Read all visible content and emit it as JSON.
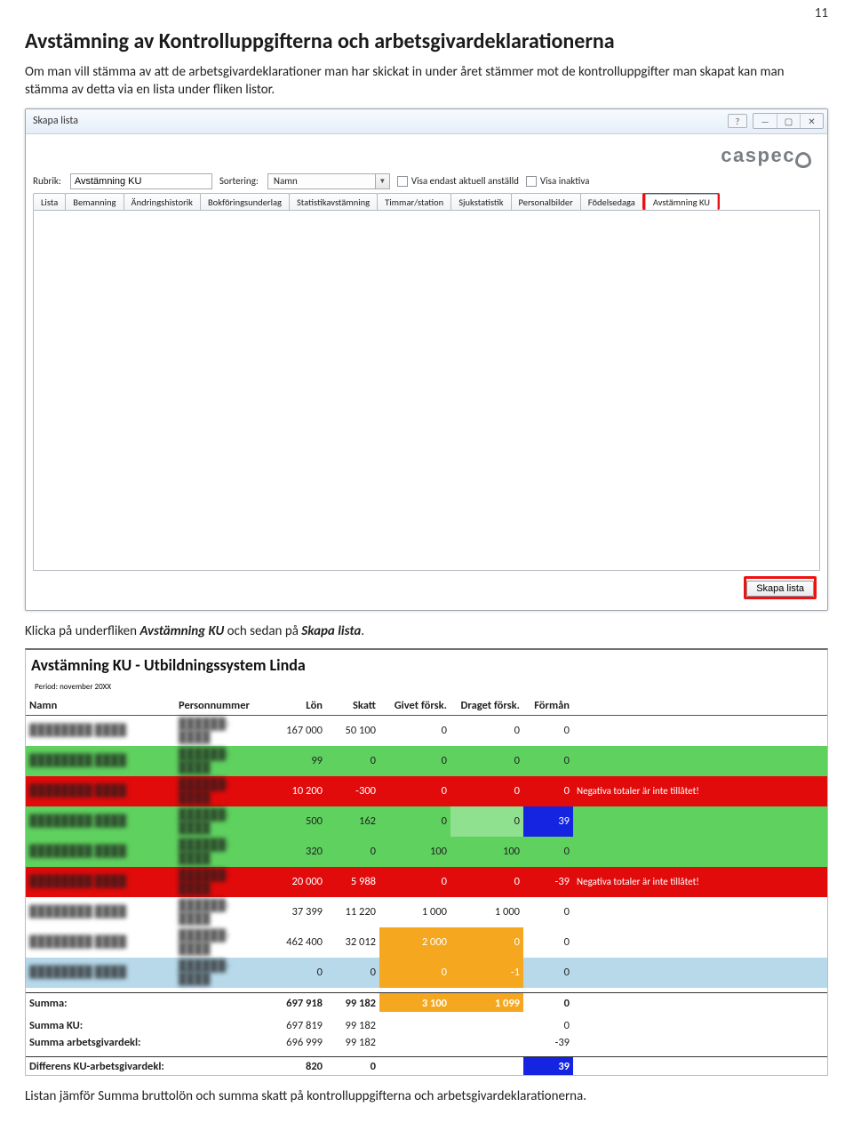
{
  "page_number": "11",
  "doc": {
    "title": "Avstämning av Kontrolluppgifterna och arbetsgivardeklarationerna",
    "intro": "Om man vill stämma av att de arbetsgivardeklarationer man har skickat in under året stämmer mot de kontrolluppgifter man skapat kan man stämma av detta via en lista under fliken listor.",
    "mid_prefix": "Klicka på underfliken ",
    "mid_tab": "Avstämning KU",
    "mid_mid": " och sedan på ",
    "mid_btn": "Skapa lista",
    "mid_suffix": ".",
    "final": "Listan jämför Summa bruttolön och summa skatt på kontrolluppgifterna och arbetsgivardeklarationerna."
  },
  "window": {
    "title": "Skapa lista",
    "help_icon": "?",
    "ctrl_min": "—",
    "ctrl_max": "▢",
    "ctrl_close": "✕",
    "logo": "caspeco",
    "labels": {
      "rubrik": "Rubrik:",
      "sortering": "Sortering:"
    },
    "rubrik_value": "Avstämning KU",
    "sort_value": "Namn",
    "chk1": "Visa endast aktuell anställd",
    "chk2": "Visa inaktiva",
    "tabs": [
      "Lista",
      "Bemanning",
      "Ändringshistorik",
      "Bokföringsunderlag",
      "Statistikavstämning",
      "Timmar/station",
      "Sjukstatistik",
      "Personalbilder",
      "Födelsedaga",
      "Avstämning KU"
    ],
    "create_btn": "Skapa lista"
  },
  "report": {
    "title": "Avstämning KU - Utbildningssystem Linda",
    "period": "Period: november 20XX",
    "headers": {
      "namn": "Namn",
      "pn": "Personnummer",
      "lon": "Lön",
      "skatt": "Skatt",
      "gf": "Givet försk.",
      "df": "Draget försk.",
      "fm": "Förmån"
    },
    "note_neg": "Negativa totaler är inte tillåtet!",
    "rows": [
      {
        "cls": "",
        "lon": "167 000",
        "skatt": "50 100",
        "gf": "0",
        "df": "0",
        "fm": "0"
      },
      {
        "cls": "row-green",
        "lon": "99",
        "skatt": "0",
        "gf": "0",
        "df": "0",
        "fm": "0"
      },
      {
        "cls": "row-red",
        "lon": "10 200",
        "skatt": "-300",
        "gf": "0",
        "df": "0",
        "fm": "0",
        "note": true
      },
      {
        "cls": "row-green",
        "lon": "500",
        "skatt": "162",
        "gf": "0",
        "df": "0",
        "fm": "39",
        "fm_blue": true,
        "df_green": true
      },
      {
        "cls": "row-green",
        "lon": "320",
        "skatt": "0",
        "gf": "100",
        "df": "100",
        "fm": "0"
      },
      {
        "cls": "row-red",
        "lon": "20 000",
        "skatt": "5 988",
        "gf": "0",
        "df": "0",
        "fm": "-39",
        "note": true
      },
      {
        "cls": "",
        "lon": "37 399",
        "skatt": "11 220",
        "gf": "1 000",
        "df": "1 000",
        "fm": "0"
      },
      {
        "cls": "",
        "lon": "462 400",
        "skatt": "32 012",
        "gf": "2 000",
        "df": "0",
        "fm": "0",
        "gf_orange": true,
        "df_orange": true
      },
      {
        "cls": "row-lblue",
        "lon": "0",
        "skatt": "0",
        "gf": "0",
        "df": "-1",
        "fm": "0",
        "gf_orange": true,
        "df_orange": true
      }
    ],
    "summa_label": "Summa:",
    "summa": {
      "lon": "697 918",
      "skatt": "99 182",
      "gf": "3 100",
      "df": "1 099",
      "fm": "0"
    },
    "summa_ku_label": "Summa KU:",
    "summa_ku": {
      "lon": "697 819",
      "skatt": "99 182",
      "fm": "0"
    },
    "summa_agd_label": "Summa arbetsgivardekl:",
    "summa_agd": {
      "lon": "696 999",
      "skatt": "99 182",
      "fm": "-39"
    },
    "diff_label": "Differens KU-arbetsgivardekl:",
    "diff": {
      "lon": "820",
      "skatt": "0",
      "fm": "39"
    }
  }
}
